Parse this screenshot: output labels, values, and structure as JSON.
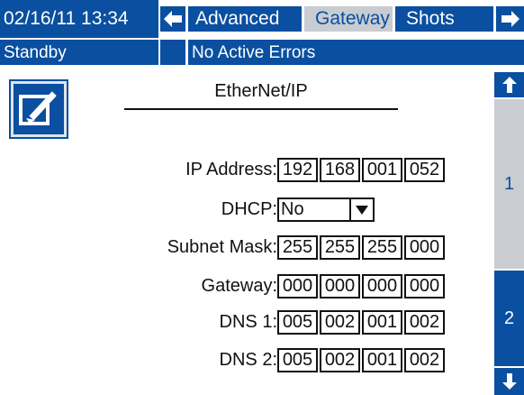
{
  "header": {
    "datetime": "02/16/11 13:34",
    "back_icon": "left-arrow-icon",
    "tabs": [
      {
        "label": "Advanced",
        "selected": false
      },
      {
        "label": "Gateway",
        "selected": true
      },
      {
        "label": "Shots",
        "selected": false
      }
    ],
    "forward_icon": "right-arrow-icon"
  },
  "status": {
    "mode": "Standby",
    "errors": "No Active Errors"
  },
  "screen": {
    "edit_icon": "edit-pencil-icon",
    "title": "EtherNet/IP",
    "fields": {
      "ip_address": {
        "label": "IP Address:",
        "octets": [
          "192",
          "168",
          "001",
          "052"
        ]
      },
      "dhcp": {
        "label": "DHCP:",
        "value": "No"
      },
      "subnet_mask": {
        "label": "Subnet Mask:",
        "octets": [
          "255",
          "255",
          "255",
          "000"
        ]
      },
      "gateway": {
        "label": "Gateway:",
        "octets": [
          "000",
          "000",
          "000",
          "000"
        ]
      },
      "dns1": {
        "label": "DNS 1:",
        "octets": [
          "005",
          "002",
          "001",
          "002"
        ]
      },
      "dns2": {
        "label": "DNS 2:",
        "octets": [
          "005",
          "002",
          "001",
          "002"
        ]
      }
    }
  },
  "pager": {
    "up_icon": "up-arrow-icon",
    "pages": [
      "1",
      "2"
    ],
    "current_page": "1",
    "down_icon": "down-arrow-icon"
  },
  "colors": {
    "accent": "#0a4fa0",
    "selected_tab": "#c9ccd1",
    "background": "#ffffff"
  }
}
